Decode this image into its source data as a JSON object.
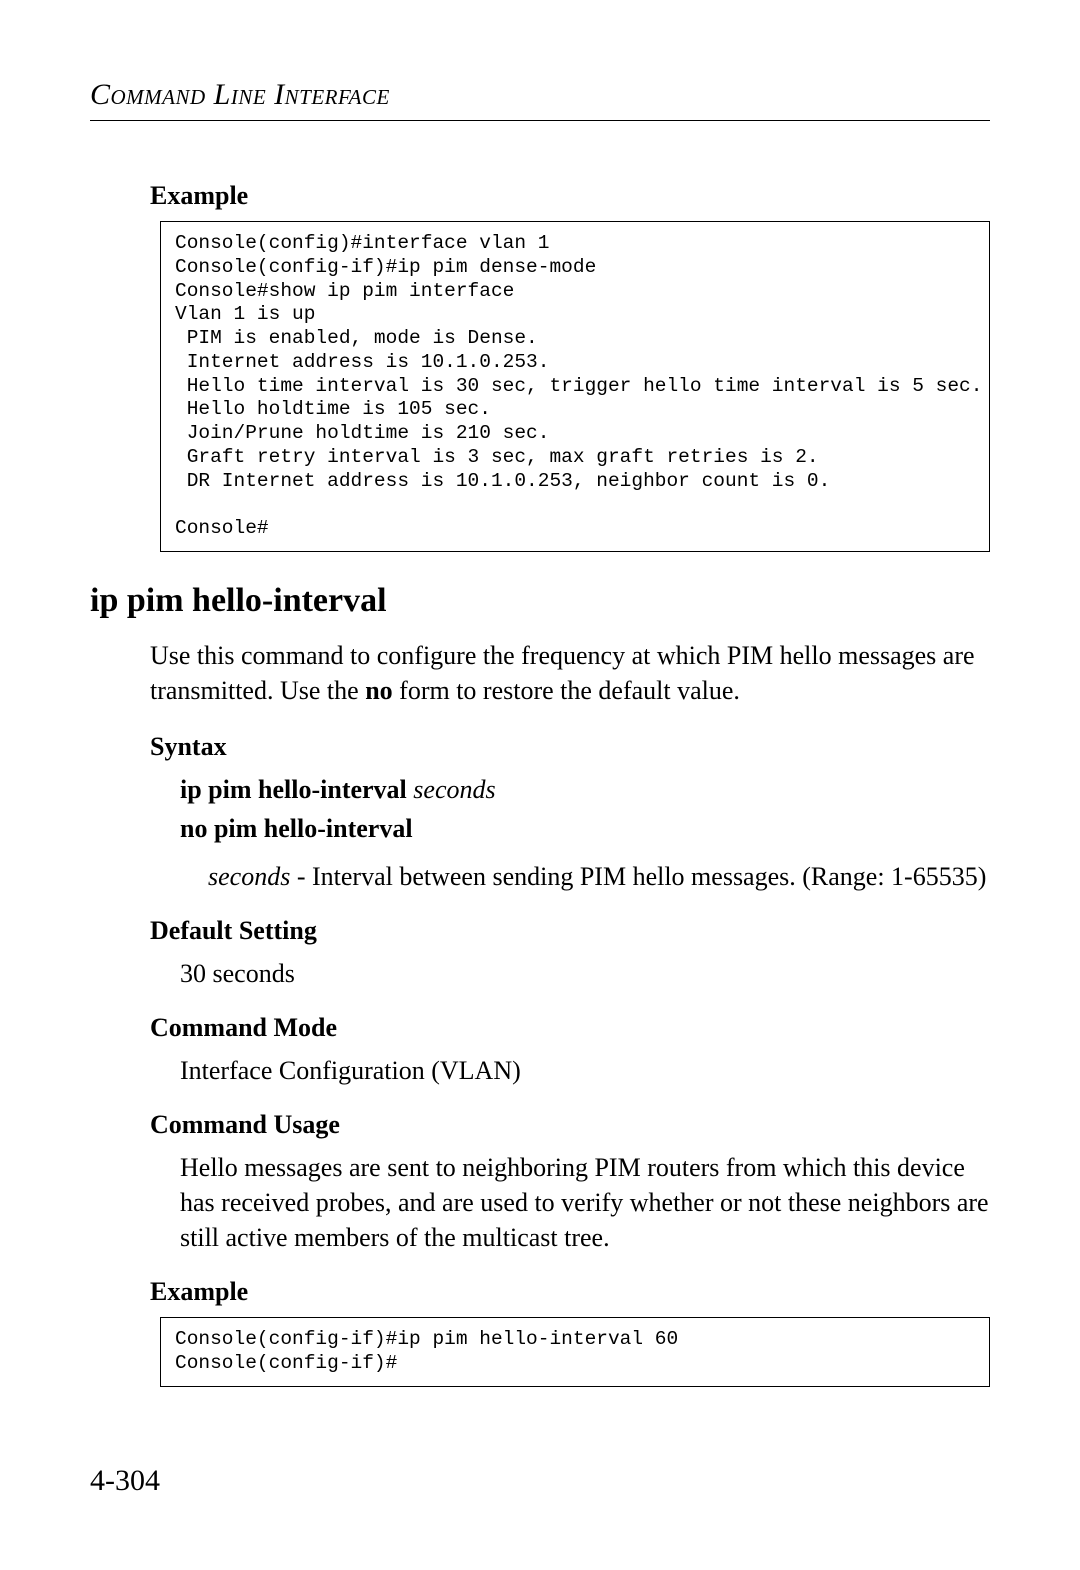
{
  "header": {
    "running_title": "Command Line Interface"
  },
  "example1": {
    "label": "Example",
    "code": "Console(config)#interface vlan 1\nConsole(config-if)#ip pim dense-mode\nConsole#show ip pim interface\nVlan 1 is up\n PIM is enabled, mode is Dense.\n Internet address is 10.1.0.253.\n Hello time interval is 30 sec, trigger hello time interval is 5 sec.\n Hello holdtime is 105 sec.\n Join/Prune holdtime is 210 sec.\n Graft retry interval is 3 sec, max graft retries is 2.\n DR Internet address is 10.1.0.253, neighbor count is 0.\n\nConsole#"
  },
  "command": {
    "heading": "ip pim hello-interval",
    "description_pre": "Use this command to configure the frequency at which PIM hello messages are transmitted. Use the ",
    "description_bold": "no",
    "description_post": " form to restore the default value."
  },
  "syntax": {
    "label": "Syntax",
    "line1_bold": "ip pim hello-interval",
    "line1_ital": "seconds",
    "line2_bold": "no pim hello-interval",
    "param_ital": "seconds",
    "param_text": " - Interval between sending PIM hello messages. (Range: 1-65535)"
  },
  "default_setting": {
    "label": "Default Setting",
    "value": "30 seconds"
  },
  "command_mode": {
    "label": "Command Mode",
    "value": "Interface Configuration (VLAN)"
  },
  "command_usage": {
    "label": "Command Usage",
    "value": "Hello messages are sent to neighboring PIM routers from which this device has received probes, and are used to verify whether or not these neighbors are still active members of the multicast tree."
  },
  "example2": {
    "label": "Example",
    "code": "Console(config-if)#ip pim hello-interval 60\nConsole(config-if)#"
  },
  "page_number": "4-304"
}
